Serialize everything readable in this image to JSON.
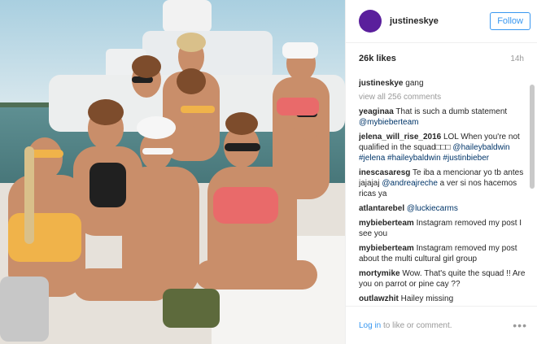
{
  "header": {
    "username": "justineskye",
    "follow_label": "Follow",
    "avatar_color": "#5a1f9c"
  },
  "meta": {
    "likes": "26k likes",
    "time": "14h"
  },
  "caption": {
    "user": "justineskye",
    "text": "gang"
  },
  "view_all": "view all 256 comments",
  "comments": [
    {
      "user": "yeaginaa",
      "text": "That is such a dumb statement ",
      "mention": "@mybieberteam"
    },
    {
      "user": "jelena_will_rise_2016",
      "text": "LOL When you're not qualified in the squad□□□",
      "mention": "@haileybaldwin #jelena #haileybaldwin #justinbieber"
    },
    {
      "user": "inescasaresg",
      "text": "Te iba a mencionar yo tb antes jajajaj ",
      "mention": "@andreajreche",
      "text2": " a ver si nos hacemos ricas ya"
    },
    {
      "user": "atlantarebel",
      "text": "",
      "mention": "@luckiecarms"
    },
    {
      "user": "mybieberteam",
      "text": "Instagram removed my post I see you"
    },
    {
      "user": "mybieberteam",
      "text": "Instagram removed my post about the multi cultural girl group"
    },
    {
      "user": "mortymike",
      "text": "Wow. That's quite the squad !! Are you on parrot or pine cay ??"
    },
    {
      "user": "outlawzhit",
      "text": "Hailey missing"
    }
  ],
  "footer": {
    "login_link": "Log in",
    "login_text": " to like or comment.",
    "more": "•••"
  },
  "colors": {
    "link": "#3897f0",
    "mention": "#003569"
  }
}
